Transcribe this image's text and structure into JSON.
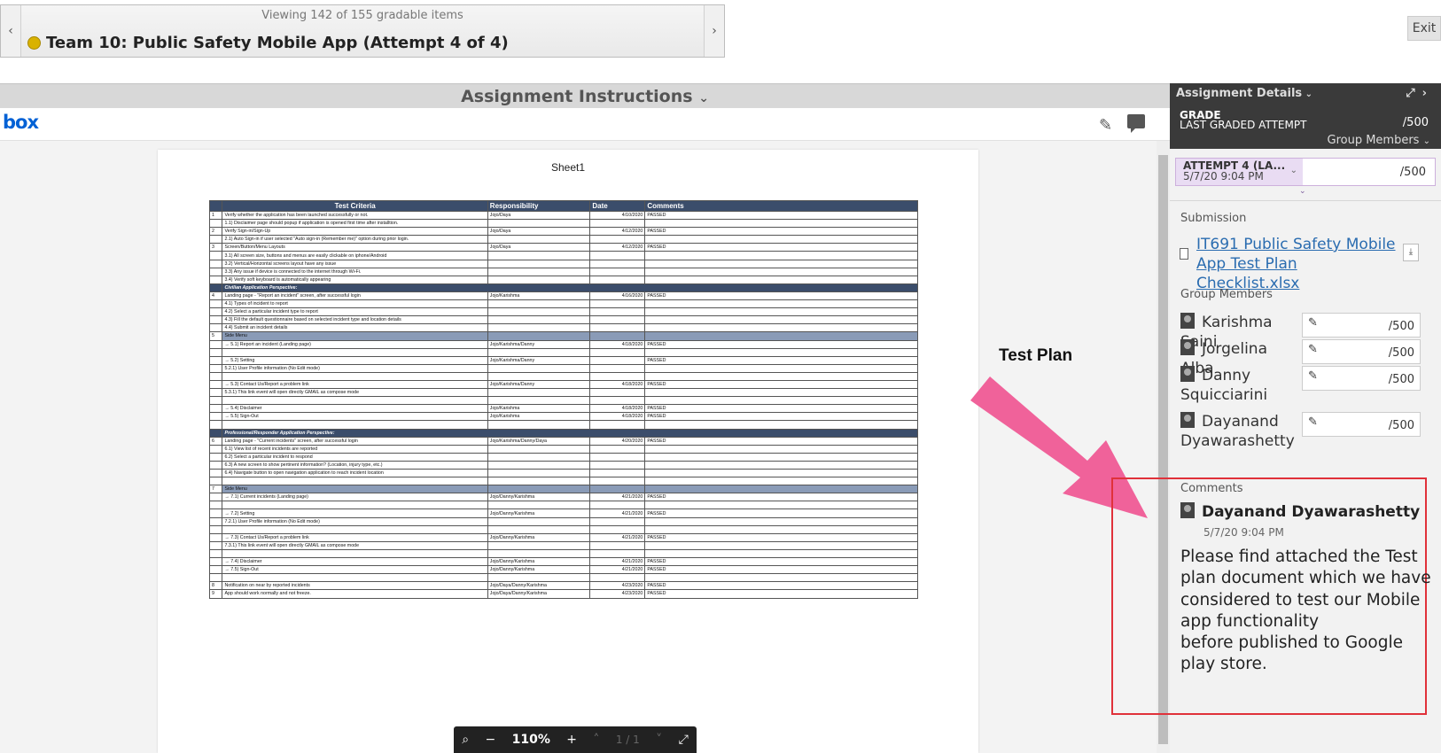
{
  "nav": {
    "viewing": "Viewing 142 of 155 gradable items",
    "title": "Team 10: Public Safety Mobile App (Attempt 4 of 4)",
    "prev_icon": "chevron-left-icon",
    "next_icon": "chevron-right-icon",
    "exit": "Exit"
  },
  "instructions": {
    "label": "Assignment Instructions",
    "chevron": "⌄"
  },
  "viewer": {
    "logo": "box",
    "sheet_title": "Sheet1",
    "zoom": {
      "level": "110%",
      "page": "1 / 1",
      "minus": "−",
      "plus": "+"
    },
    "table": {
      "headers": [
        "",
        "Test Criteria",
        "Responsibility",
        "Date",
        "Comments"
      ],
      "rows": [
        {
          "type": "row",
          "n": "1",
          "c": "Verify whether the application has been launched successfully or not.",
          "r": "Jojo/Daya",
          "d": "4/10/2020",
          "s": "PASSED"
        },
        {
          "type": "row",
          "n": "",
          "c": "1.1) Disclaimer page should popup if application is opened first time after installtion.",
          "r": "",
          "d": "",
          "s": ""
        },
        {
          "type": "row",
          "n": "2",
          "c": "Verify Sign-in/Sign-Up",
          "r": "Jojo/Daya",
          "d": "4/12/2020",
          "s": "PASSED"
        },
        {
          "type": "row",
          "n": "",
          "c": "2.1) Auto Sign-in if user selected \"Auto sign-in (Remember me)\" option during prior login.",
          "r": "",
          "d": "",
          "s": ""
        },
        {
          "type": "row",
          "n": "3",
          "c": "Screen/Button/Menu Layouts",
          "r": "Jojo/Daya",
          "d": "4/12/2020",
          "s": "PASSED"
        },
        {
          "type": "row",
          "n": "",
          "c": "3.1) All screen size, buttons and menus are easily clickable on iphone/Android",
          "r": "",
          "d": "",
          "s": ""
        },
        {
          "type": "row",
          "n": "",
          "c": "3.2) Vertical/Horizontal screens layout have any issue",
          "r": "",
          "d": "",
          "s": ""
        },
        {
          "type": "row",
          "n": "",
          "c": "3.3) Any issue if device is connected to the internet through Wi-Fi.",
          "r": "",
          "d": "",
          "s": ""
        },
        {
          "type": "row",
          "n": "",
          "c": "3.4) Verify soft keyboard is automatically appearing",
          "r": "",
          "d": "",
          "s": ""
        },
        {
          "type": "sect",
          "c": "Civilian Application Perspective:"
        },
        {
          "type": "row",
          "n": "4",
          "c": "Landing page - \"Report an incident\" screen, after successful login",
          "r": "Jojo/Karishma",
          "d": "4/16/2020",
          "s": "PASSED"
        },
        {
          "type": "row",
          "n": "",
          "c": "4.1) Types of incident to report",
          "r": "",
          "d": "",
          "s": ""
        },
        {
          "type": "row",
          "n": "",
          "c": "4.2) Select a particular incident type to report",
          "r": "",
          "d": "",
          "s": ""
        },
        {
          "type": "row",
          "n": "",
          "c": "4.3) Fill the default questionnaire based on selected incident type and location details",
          "r": "",
          "d": "",
          "s": ""
        },
        {
          "type": "row",
          "n": "",
          "c": "4.4) Submit an incident details",
          "r": "",
          "d": "",
          "s": ""
        },
        {
          "type": "sub",
          "n": "5",
          "c": "Side Menu"
        },
        {
          "type": "row",
          "n": "",
          "c": "→ 5.1) Report an incident (Landing page)",
          "r": "Jojo/Karishma/Danny",
          "d": "4/18/2020",
          "s": "PASSED"
        },
        {
          "type": "row",
          "n": "",
          "c": "",
          "r": "",
          "d": "",
          "s": ""
        },
        {
          "type": "row",
          "n": "",
          "c": "→ 5.2) Setting",
          "r": "Jojo/Karishma/Danny",
          "d": "",
          "s": "PASSED"
        },
        {
          "type": "row",
          "n": "",
          "c": "5.2.1) User Profile information (No Edit mode)",
          "r": "",
          "d": "",
          "s": ""
        },
        {
          "type": "row",
          "n": "",
          "c": "",
          "r": "",
          "d": "",
          "s": ""
        },
        {
          "type": "row",
          "n": "",
          "c": "→ 5.3) Contact Us/Report a problem link",
          "r": "Jojo/Karishma/Danny",
          "d": "4/18/2020",
          "s": "PASSED"
        },
        {
          "type": "row",
          "n": "",
          "c": "5.3.1) This link event will open directly GMAIL as compose mode",
          "r": "",
          "d": "",
          "s": ""
        },
        {
          "type": "row",
          "n": "",
          "c": "",
          "r": "",
          "d": "",
          "s": ""
        },
        {
          "type": "row",
          "n": "",
          "c": "→ 5.4) Disclaimer",
          "r": "Jojo/Karishma",
          "d": "4/18/2020",
          "s": "PASSED"
        },
        {
          "type": "row",
          "n": "",
          "c": "→ 5.5) Sign-Out",
          "r": "Jojo/Karishma",
          "d": "4/18/2020",
          "s": "PASSED"
        },
        {
          "type": "row",
          "n": "",
          "c": "",
          "r": "",
          "d": "",
          "s": ""
        },
        {
          "type": "sect",
          "c": "Professional/Responder Application Perspective:"
        },
        {
          "type": "row",
          "n": "6",
          "c": "Landing page - \"Current incidents\" screen, after successful login",
          "r": "Jojo/Karishma/Danny/Daya",
          "d": "4/20/2020",
          "s": "PASSED"
        },
        {
          "type": "row",
          "n": "",
          "c": "6.1) View list of recent incidents are reported",
          "r": "",
          "d": "",
          "s": ""
        },
        {
          "type": "row",
          "n": "",
          "c": "6.2) Select a particular incident to respond",
          "r": "",
          "d": "",
          "s": ""
        },
        {
          "type": "row",
          "n": "",
          "c": "6.3) A new screen to show pertinent information? (Location, injury type, etc.)",
          "r": "",
          "d": "",
          "s": ""
        },
        {
          "type": "row",
          "n": "",
          "c": "6.4) Navigate button to open navigation application to reach incident location",
          "r": "",
          "d": "",
          "s": ""
        },
        {
          "type": "row",
          "n": "",
          "c": "",
          "r": "",
          "d": "",
          "s": ""
        },
        {
          "type": "sub",
          "n": "7",
          "c": "Side Menu"
        },
        {
          "type": "row",
          "n": "",
          "c": "→ 7.1) Current incidents (Landing page)",
          "r": "Jojo/Danny/Karishma",
          "d": "4/21/2020",
          "s": "PASSED"
        },
        {
          "type": "row",
          "n": "",
          "c": "",
          "r": "",
          "d": "",
          "s": ""
        },
        {
          "type": "row",
          "n": "",
          "c": "→ 7.2) Setting",
          "r": "Jojo/Danny/Karishma",
          "d": "4/21/2020",
          "s": "PASSED"
        },
        {
          "type": "row",
          "n": "",
          "c": "7.2.1) User Profile information (No Edit mode)",
          "r": "",
          "d": "",
          "s": ""
        },
        {
          "type": "row",
          "n": "",
          "c": "",
          "r": "",
          "d": "",
          "s": ""
        },
        {
          "type": "row",
          "n": "",
          "c": "→ 7.3) Contact Us/Report a problem link",
          "r": "Jojo/Danny/Karishma",
          "d": "4/21/2020",
          "s": "PASSED"
        },
        {
          "type": "row",
          "n": "",
          "c": "7.3.1) This link event will open directly GMAIL as compose mode",
          "r": "",
          "d": "",
          "s": ""
        },
        {
          "type": "row",
          "n": "",
          "c": "",
          "r": "",
          "d": "",
          "s": ""
        },
        {
          "type": "row",
          "n": "",
          "c": "→ 7.4) Disclaimer",
          "r": "Jojo/Danny/Karishma",
          "d": "4/21/2020",
          "s": "PASSED"
        },
        {
          "type": "row",
          "n": "",
          "c": "→ 7.5) Sign-Out",
          "r": "Jojo/Danny/Karishma",
          "d": "4/21/2020",
          "s": "PASSED"
        },
        {
          "type": "row",
          "n": "",
          "c": "",
          "r": "",
          "d": "",
          "s": ""
        },
        {
          "type": "row",
          "n": "8",
          "c": "Notification on near by reported incidents",
          "r": "Jojo/Daya/Danny/Karishma",
          "d": "4/23/2020",
          "s": "PASSED"
        },
        {
          "type": "row",
          "n": "9",
          "c": "App should work normally and not freeze.",
          "r": "Jojo/Daya/Danny/Karishma",
          "d": "4/23/2020",
          "s": "PASSED"
        }
      ]
    }
  },
  "annotation": {
    "label": "Test Plan",
    "arrow_color": "#f0629a",
    "box_color": "#e0313a"
  },
  "panel": {
    "header": "Assignment Details",
    "grade_label": "GRADE",
    "last_graded": "LAST GRADED ATTEMPT",
    "grade_value": "/500",
    "group_members_toggle": "Group Members",
    "attempt": {
      "name": "ATTEMPT 4 (LA...",
      "date": "5/7/20 9:04 PM",
      "score": "/500"
    },
    "submission_label": "Submission",
    "submission_file": "IT691 Public Safety Mobile App Test Plan Checklist.xlsx",
    "members_label": "Group Members",
    "members": [
      {
        "name": "Karishma Saini",
        "score": "/500"
      },
      {
        "name": "Jorgelina Alba",
        "score": "/500"
      },
      {
        "name": "Danny Squicciarini",
        "score": "/500"
      },
      {
        "name": "Dayanand Dyawarashetty",
        "score": "/500"
      }
    ],
    "comments_label": "Comments",
    "comment": {
      "author": "Dayanand Dyawarashetty",
      "date": "5/7/20 9:04 PM",
      "text_line1": "Please find attached the Test plan document which we have considered to test our Mobile app functionality",
      "text_line2": "before published to Google play store."
    }
  }
}
